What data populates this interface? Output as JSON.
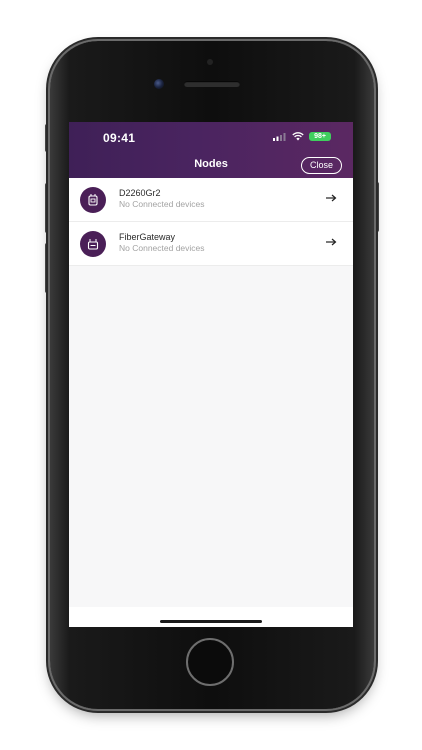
{
  "status_bar": {
    "time": "09:41",
    "battery": "98+"
  },
  "header": {
    "title": "Nodes",
    "close_label": "Close"
  },
  "nodes": [
    {
      "name": "D2260Gr2",
      "status": "No Connected devices",
      "icon": "router-icon"
    },
    {
      "name": "FiberGateway",
      "status": "No Connected devices",
      "icon": "gateway-icon"
    }
  ],
  "colors": {
    "header_start": "#3f2057",
    "header_end": "#5b2862",
    "avatar_bg": "#4a1f57",
    "battery_green": "#3fcf5e"
  }
}
